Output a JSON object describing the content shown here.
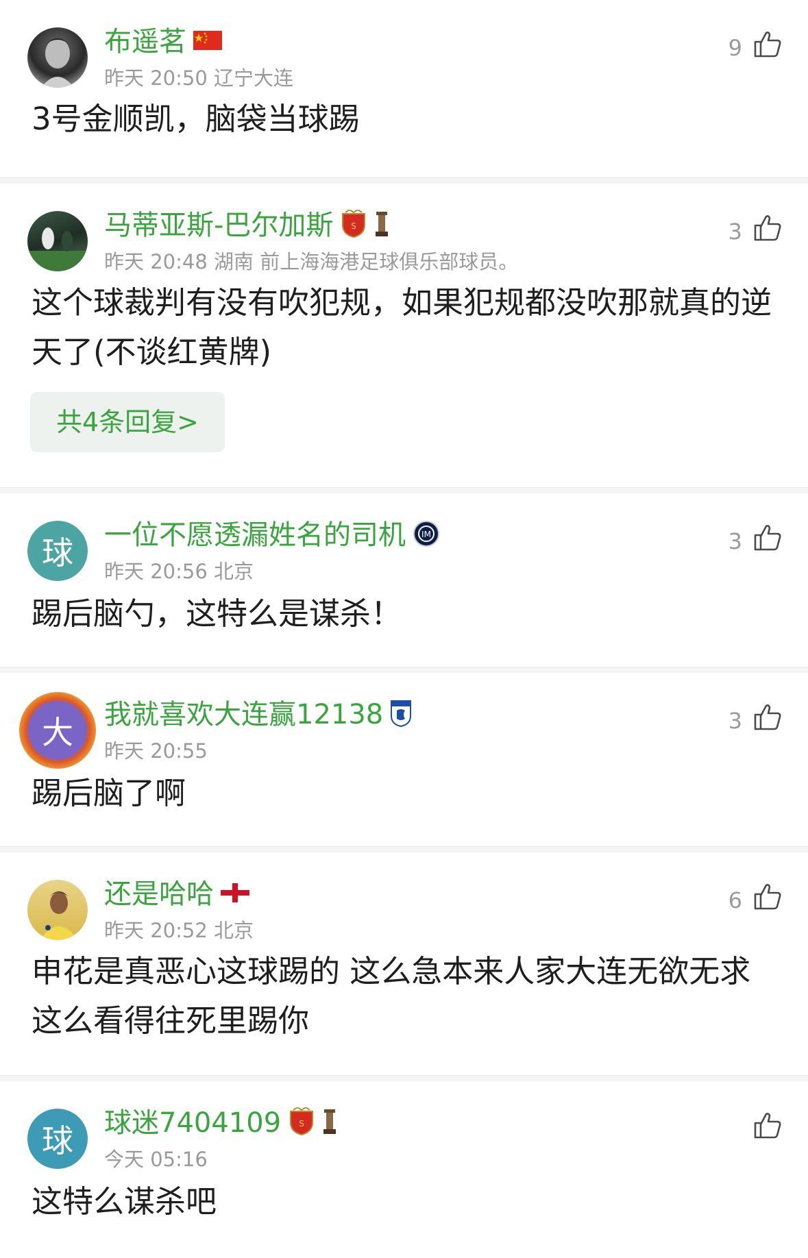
{
  "comments": [
    {
      "name": "布遥茗",
      "meta": "昨天 20:50 辽宁大连",
      "likes": "9",
      "text": "3号金顺凯，脑袋当球踢"
    },
    {
      "name": "马蒂亚斯-巴尔加斯",
      "meta": "昨天 20:48 湖南 前上海海港足球俱乐部球员。",
      "likes": "3",
      "text": "这个球裁判有没有吹犯规，如果犯规都没吹那就真的逆天了(不谈红黄牌)",
      "reply_label": "共4条回复>"
    },
    {
      "avatar_char": "球",
      "name": "一位不愿透漏姓名的司机",
      "meta": "昨天 20:56 北京",
      "likes": "3",
      "text": "踢后脑勺，这特么是谋杀！"
    },
    {
      "avatar_char": "大",
      "name": "我就喜欢大连赢12138",
      "meta": "昨天 20:55",
      "likes": "3",
      "text": "踢后脑了啊"
    },
    {
      "name": "还是哈哈",
      "meta": "昨天 20:52 北京",
      "likes": "6",
      "text": "申花是真恶心这球踢的 这么急本来人家大连无欲无求这么看得往死里踢你"
    },
    {
      "avatar_char": "球",
      "name": "球迷7404109",
      "meta": "今天 05:16",
      "likes": "",
      "text": "这特么谋杀吧"
    }
  ],
  "colors": {
    "name_green": "#3aa53e",
    "meta_gray": "#9a9a9a",
    "avatar_teal": "#4ca5a3"
  },
  "icons": [
    "thumbs-up-icon",
    "china-flag-icon",
    "shanghai-port-badge-icon",
    "trophy-icon",
    "inter-milan-badge-icon",
    "dalian-badge-icon",
    "england-flag-icon"
  ]
}
